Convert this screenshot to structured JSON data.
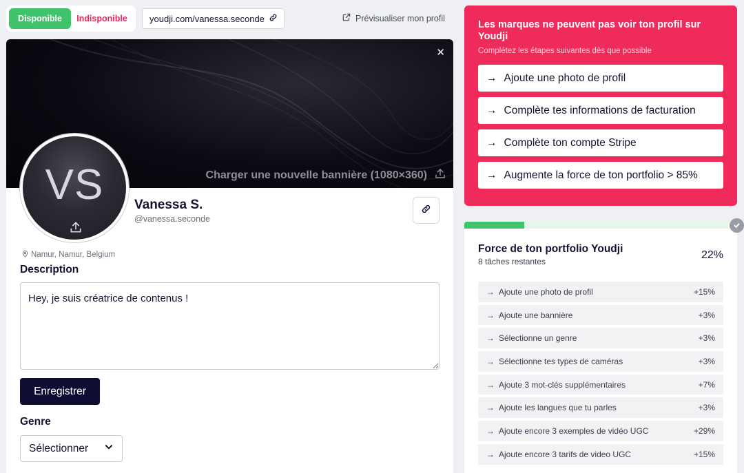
{
  "availability": {
    "available": "Disponible",
    "unavailable": "Indisponible"
  },
  "profile_url": "youdji.com/vanessa.seconde",
  "preview_label": "Prévisualiser mon profil",
  "banner": {
    "upload_label": "Charger une nouvelle bannière (1080×360)"
  },
  "profile": {
    "initials": "VS",
    "name": "Vanessa S.",
    "handle": "@vanessa.seconde",
    "location": "Namur, Namur, Belgium"
  },
  "description": {
    "heading": "Description",
    "value": "Hey, je suis créatrice de contenus !",
    "save_label": "Enregistrer"
  },
  "genre": {
    "heading": "Genre",
    "selected": "Sélectionner"
  },
  "alert": {
    "title": "Les marques ne peuvent pas voir ton profil sur Youdji",
    "subtitle": "Complétez les étapes suivantes dès que possible",
    "items": [
      "Ajoute une photo de profil",
      "Complète tes informations de facturation",
      "Complète ton compte Stripe",
      "Augmente la force de ton portfolio > 85%"
    ]
  },
  "strength": {
    "title": "Force de ton portfolio Youdji",
    "remaining": "8 tâches restantes",
    "percent_label": "22%",
    "progress_percent": 22,
    "items": [
      {
        "label": "Ajoute une photo de profil",
        "value": "+15%"
      },
      {
        "label": "Ajoute une bannière",
        "value": "+3%"
      },
      {
        "label": "Sélectionne un genre",
        "value": "+3%"
      },
      {
        "label": "Sélectionne tes types de caméras",
        "value": "+3%"
      },
      {
        "label": "Ajoute 3 mot-clés supplémentaires",
        "value": "+7%"
      },
      {
        "label": "Ajoute les langues que tu parles",
        "value": "+3%"
      },
      {
        "label": "Ajoute encore 3 exemples de vidéo UGC",
        "value": "+29%"
      },
      {
        "label": "Ajoute encore 3 tarifs de video UGC",
        "value": "+15%"
      }
    ]
  },
  "colors": {
    "green": "#3fc46b",
    "red": "#ee2b5a",
    "navy": "#0f0d33"
  }
}
